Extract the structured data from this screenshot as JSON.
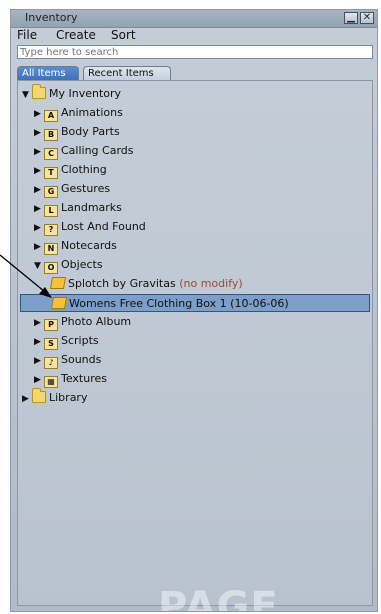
{
  "window": {
    "title": "Inventory"
  },
  "menu": [
    "File",
    "Create",
    "Sort"
  ],
  "search": {
    "placeholder": "Type here to search"
  },
  "tabs": [
    "All Items",
    "Recent Items"
  ],
  "tree": [
    {
      "label": "My Inventory",
      "depth": 0,
      "expanded": true,
      "icon": "folder-icon"
    },
    {
      "label": "Animations",
      "depth": 1,
      "expanded": false,
      "icon": "animation-icon"
    },
    {
      "label": "Body Parts",
      "depth": 1,
      "expanded": false,
      "icon": "body-parts-icon"
    },
    {
      "label": "Calling Cards",
      "depth": 1,
      "expanded": false,
      "icon": "calling-card-icon"
    },
    {
      "label": "Clothing",
      "depth": 1,
      "expanded": false,
      "icon": "clothing-icon"
    },
    {
      "label": "Gestures",
      "depth": 1,
      "expanded": false,
      "icon": "gesture-icon"
    },
    {
      "label": "Landmarks",
      "depth": 1,
      "expanded": false,
      "icon": "landmark-icon"
    },
    {
      "label": "Lost And Found",
      "depth": 1,
      "expanded": false,
      "icon": "lost-found-icon"
    },
    {
      "label": "Notecards",
      "depth": 1,
      "expanded": false,
      "icon": "notecard-icon"
    },
    {
      "label": "Objects",
      "depth": 1,
      "expanded": true,
      "icon": "objects-icon"
    },
    {
      "label": "Splotch by Gravitas",
      "suffix": "(no modify)",
      "depth": 2,
      "icon": "box-icon"
    },
    {
      "label": "Womens Free Clothing Box 1 (10-06-06)",
      "depth": 2,
      "icon": "box-icon",
      "selected": true
    },
    {
      "label": "Photo Album",
      "depth": 1,
      "expanded": false,
      "icon": "photo-album-icon"
    },
    {
      "label": "Scripts",
      "depth": 1,
      "expanded": false,
      "icon": "script-icon"
    },
    {
      "label": "Sounds",
      "depth": 1,
      "expanded": false,
      "icon": "sound-icon"
    },
    {
      "label": "Textures",
      "depth": 1,
      "expanded": false,
      "icon": "texture-icon"
    },
    {
      "label": "Library",
      "depth": 0,
      "expanded": false,
      "icon": "folder-icon"
    }
  ],
  "watermark": "PAGE"
}
